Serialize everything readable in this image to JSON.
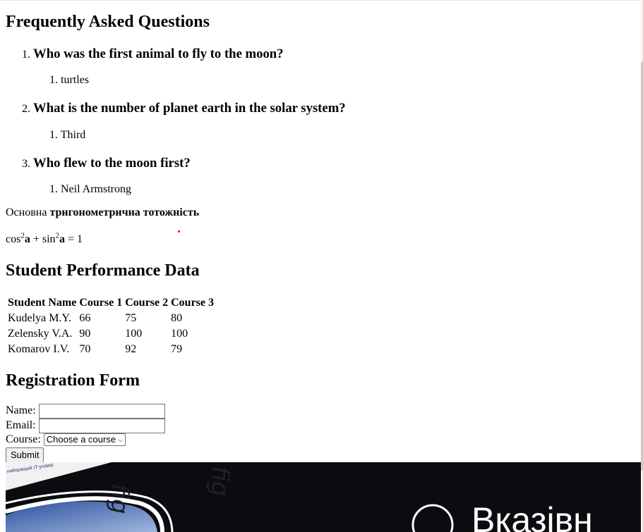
{
  "faq": {
    "title": "Frequently Asked Questions",
    "items": [
      {
        "num": "1.",
        "question": "Who was the first animal to fly to the moon?",
        "answer_num": "1.",
        "answer": "turtles"
      },
      {
        "num": "2.",
        "question": "What is the number of planet earth in the solar system?",
        "answer_num": "1.",
        "answer": "Third"
      },
      {
        "num": "3.",
        "question": "Who flew to the moon first?",
        "answer_num": "1.",
        "answer": "Neil Armstrong"
      }
    ]
  },
  "identity": {
    "prefix": "Основна",
    "bold": "тригонометрична тотожність",
    "cos": "cos",
    "sin": "sin",
    "exp": "2",
    "var": "a",
    "plus": " + ",
    "equals": " = 1"
  },
  "performance": {
    "title": "Student Performance Data",
    "headers": [
      "Student Name",
      "Course 1",
      "Course 2",
      "Course 3"
    ],
    "rows": [
      [
        "Kudelya M.Y.",
        "66",
        "75",
        "80"
      ],
      [
        "Zelensky V.A.",
        "90",
        "100",
        "100"
      ],
      [
        "Komarov I.V.",
        "70",
        "92",
        "79"
      ]
    ]
  },
  "form": {
    "title": "Registration Form",
    "name_label": "Name:",
    "email_label": "Email:",
    "course_label": "Course:",
    "course_selected": "Choose a course",
    "submit_label": "Submit"
  },
  "banner": {
    "small_text": "найкращий IT-універ",
    "brand_text": "Вказівн"
  },
  "colors": {
    "banner_bg": "#0b0b10",
    "accent_red": "#d40000",
    "banner_blue": "#3d6fd1"
  }
}
